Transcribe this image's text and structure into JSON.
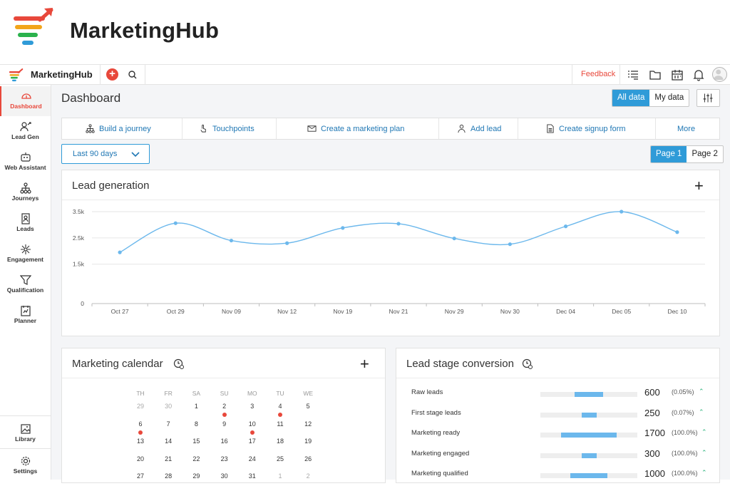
{
  "brand": {
    "name": "MarketingHub"
  },
  "topbar": {
    "app_name": "MarketingHub",
    "feedback": "Feedback"
  },
  "sidebar": {
    "items": [
      {
        "label": "Dashboard",
        "icon": "dashboard-icon"
      },
      {
        "label": "Lead Gen",
        "icon": "lead-gen-icon"
      },
      {
        "label": "Web Assistant",
        "icon": "web-assistant-icon"
      },
      {
        "label": "Journeys",
        "icon": "journeys-icon"
      },
      {
        "label": "Leads",
        "icon": "leads-icon"
      },
      {
        "label": "Engagement",
        "icon": "engagement-icon"
      },
      {
        "label": "Qualification",
        "icon": "funnel-icon"
      },
      {
        "label": "Planner",
        "icon": "planner-icon"
      }
    ],
    "bottom": [
      {
        "label": "Library",
        "icon": "library-icon"
      },
      {
        "label": "Settings",
        "icon": "settings-icon"
      }
    ]
  },
  "page": {
    "title": "Dashboard",
    "data_toggle": {
      "all": "All data",
      "mine": "My data",
      "selected": "All data"
    }
  },
  "actions": [
    {
      "label": "Build a journey",
      "icon": "journey-icon"
    },
    {
      "label": "Touchpoints",
      "icon": "touch-icon"
    },
    {
      "label": "Create a marketing plan",
      "icon": "mail-icon"
    },
    {
      "label": "Add lead",
      "icon": "add-person-icon"
    },
    {
      "label": "Create signup form",
      "icon": "form-icon"
    },
    {
      "label": "More",
      "icon": ""
    }
  ],
  "filters": {
    "range": "Last 90 days"
  },
  "pager": {
    "page1": "Page 1",
    "page2": "Page 2",
    "selected": "Page 1"
  },
  "lead_generation": {
    "title": "Lead generation",
    "chart_data": {
      "type": "line",
      "title": "Lead generation",
      "x": [
        "Oct 27",
        "Oct 29",
        "Nov 09",
        "Nov 12",
        "Nov 19",
        "Nov 21",
        "Nov 29",
        "Nov 30",
        "Dec 04",
        "Dec 05",
        "Dec 10"
      ],
      "series": [
        {
          "values": [
            1950,
            3060,
            2400,
            2300,
            2880,
            3040,
            2480,
            2260,
            2940,
            3500,
            2720
          ]
        }
      ],
      "y_ticks": [
        "0",
        "1.5k",
        "2.5k",
        "3.5k"
      ],
      "ylim": [
        0,
        3500
      ],
      "grid": true,
      "color": "#6cb8ec"
    }
  },
  "calendar": {
    "title": "Marketing calendar",
    "weekdays": [
      "TH",
      "FR",
      "SA",
      "SU",
      "MO",
      "TU",
      "WE"
    ],
    "weeks": [
      [
        "29",
        "30",
        "1",
        "2",
        "3",
        "4",
        "5"
      ],
      [
        "6",
        "7",
        "8",
        "9",
        "10",
        "11",
        "12"
      ],
      [
        "13",
        "14",
        "15",
        "16",
        "17",
        "18",
        "19"
      ],
      [
        "20",
        "21",
        "22",
        "23",
        "24",
        "25",
        "26"
      ],
      [
        "27",
        "28",
        "29",
        "30",
        "31",
        "1",
        "2"
      ]
    ],
    "muted": [
      [
        0,
        0
      ],
      [
        0,
        1
      ],
      [
        4,
        5
      ],
      [
        4,
        6
      ]
    ],
    "events": [
      [
        0,
        3
      ],
      [
        0,
        5
      ],
      [
        1,
        0
      ],
      [
        1,
        4
      ]
    ]
  },
  "lead_stage": {
    "title": "Lead stage conversion",
    "rows": [
      {
        "name": "Raw leads",
        "value": "600",
        "pct": "(0.05%)",
        "bar": [
          0.35,
          0.65
        ]
      },
      {
        "name": "First stage leads",
        "value": "250",
        "pct": "(0.07%)",
        "bar": [
          0.43,
          0.58
        ]
      },
      {
        "name": "Marketing ready",
        "value": "1700",
        "pct": "(100.0%)",
        "bar": [
          0.21,
          0.79
        ]
      },
      {
        "name": "Marketing engaged",
        "value": "300",
        "pct": "(100.0%)",
        "bar": [
          0.43,
          0.58
        ]
      },
      {
        "name": "Marketing qualified",
        "value": "1000",
        "pct": "(100.0%)",
        "bar": [
          0.31,
          0.69
        ]
      }
    ]
  },
  "colors": {
    "accent_red": "#e8483b",
    "accent_blue": "#2f9bd8",
    "link_blue": "#1f77b4",
    "chart_line": "#6cb8ec"
  }
}
